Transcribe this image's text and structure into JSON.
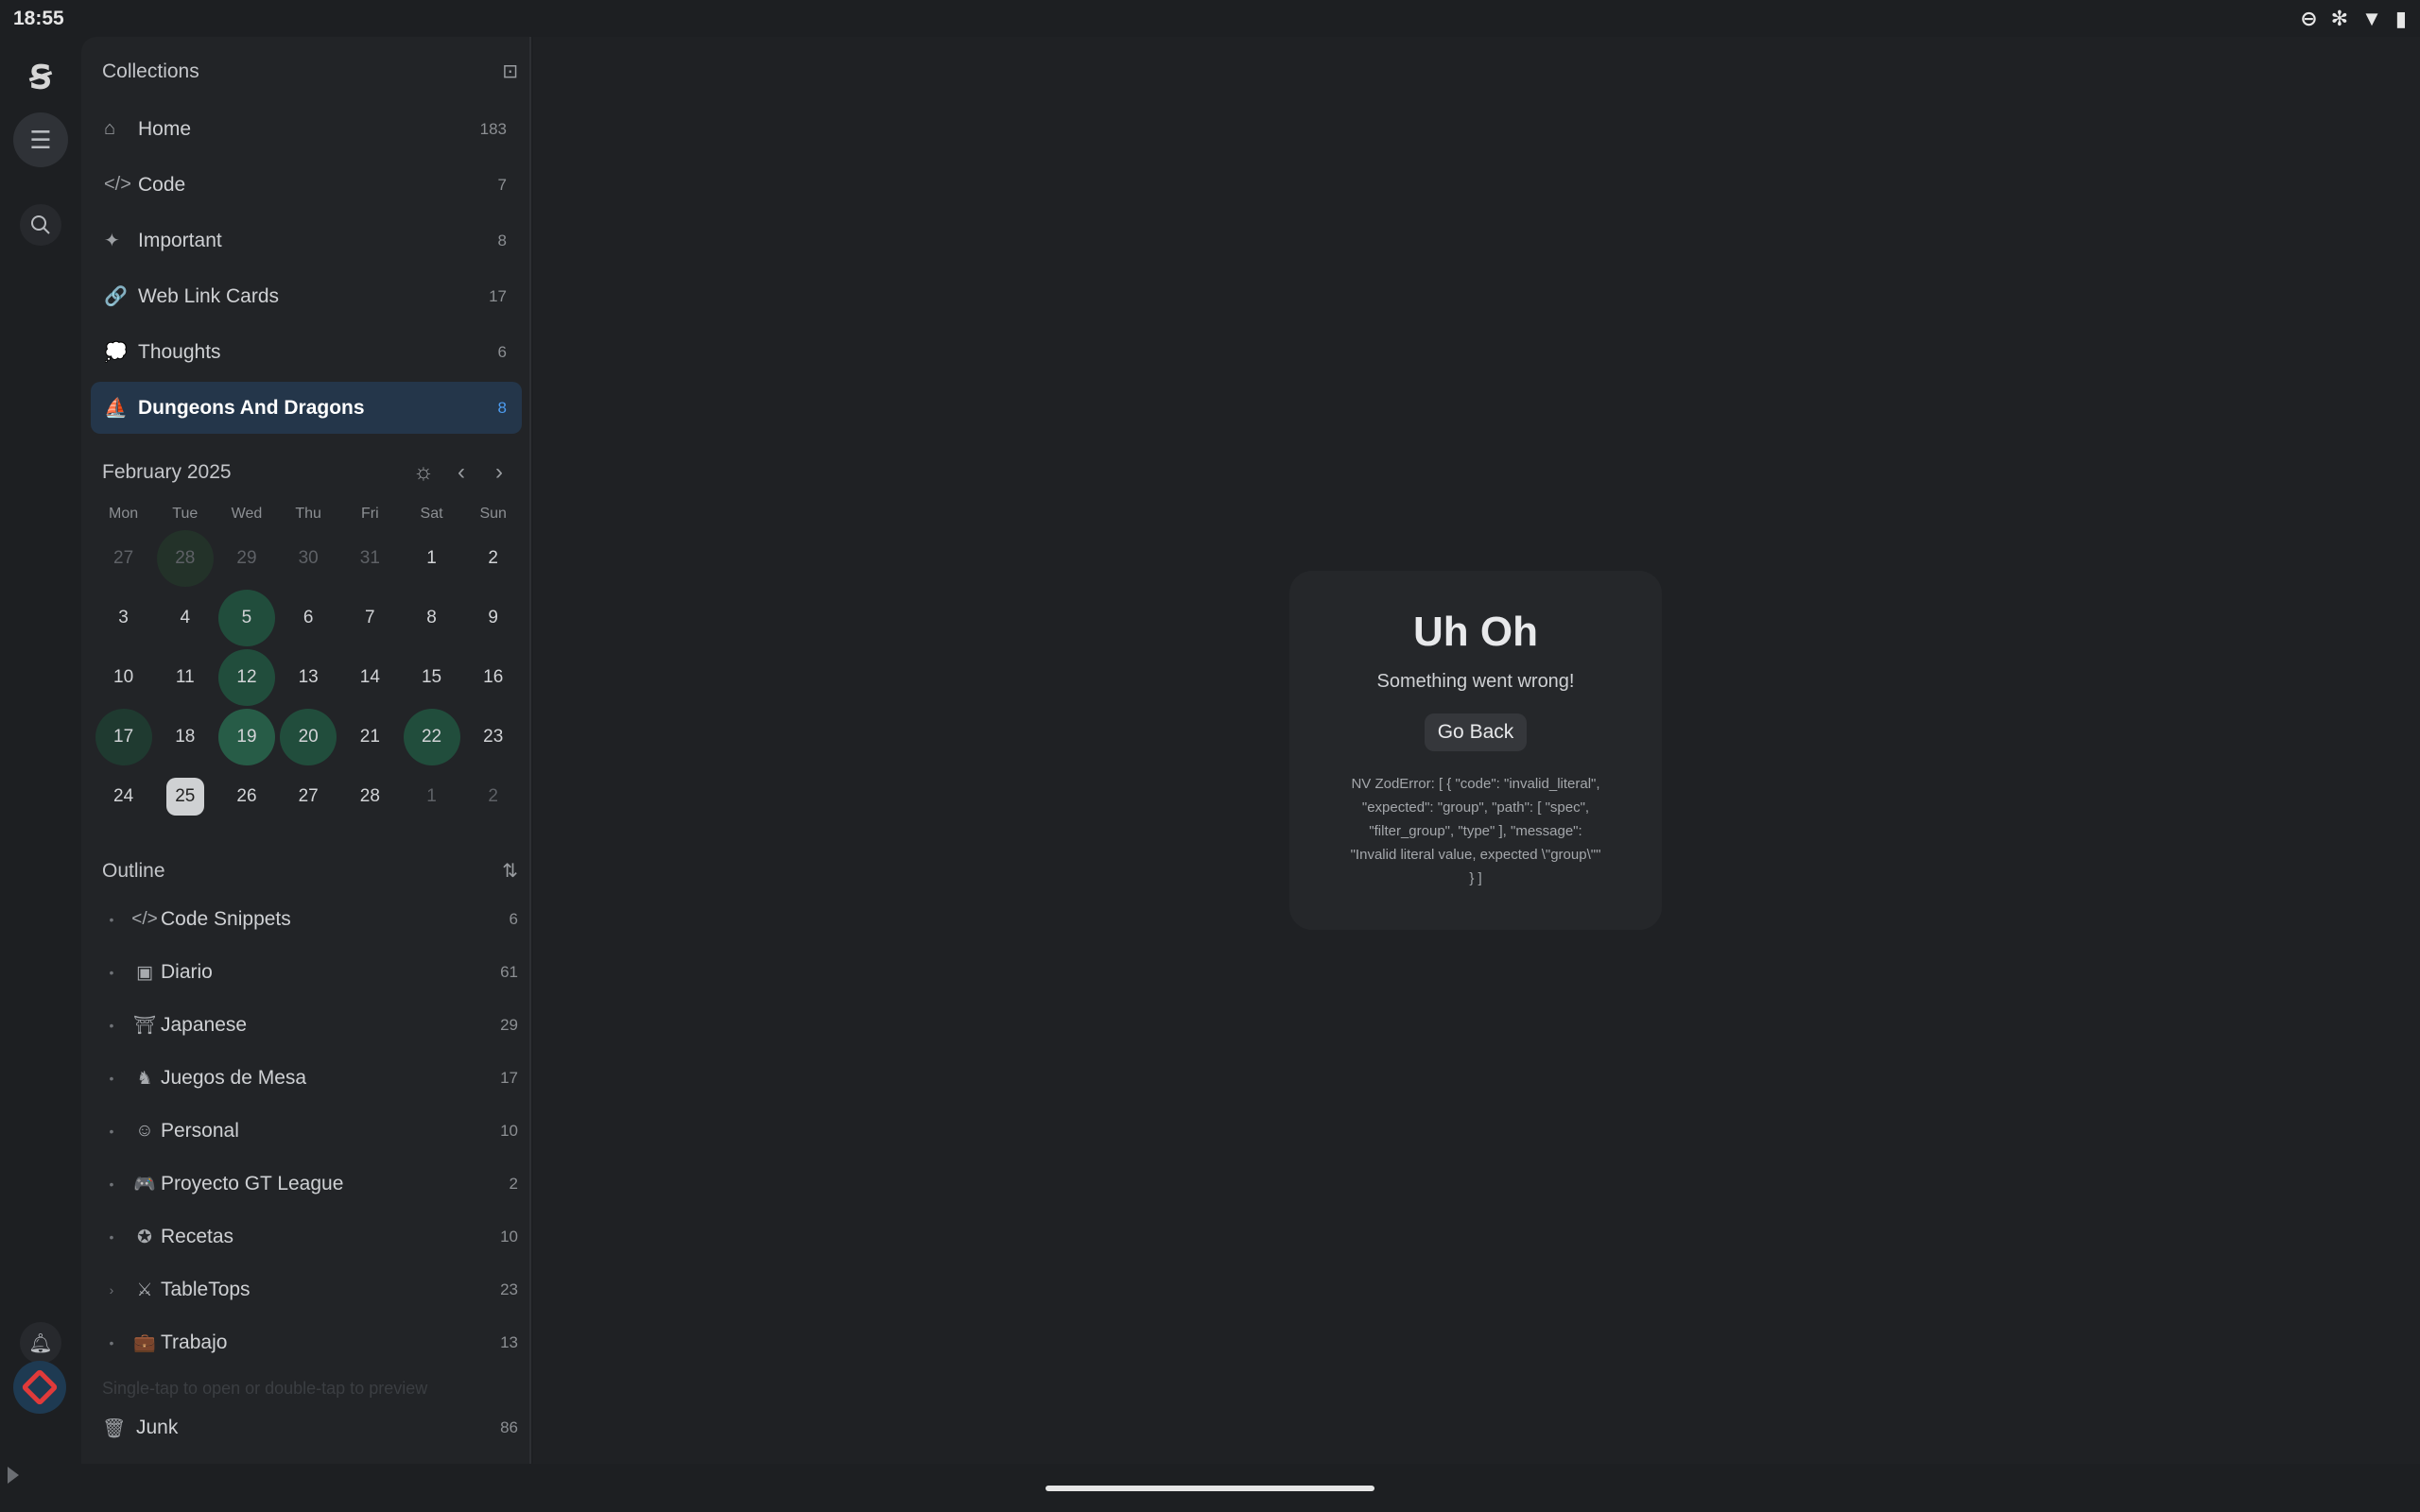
{
  "status_bar": {
    "time": "18:55",
    "icons": [
      "dnd-icon",
      "bluetooth-icon",
      "wifi-icon",
      "battery-icon"
    ]
  },
  "rail": {
    "logo": "ꞩ"
  },
  "collections": {
    "title": "Collections",
    "items": [
      {
        "label": "Home",
        "count": "183",
        "icon": "⌂",
        "active": false
      },
      {
        "label": "Code",
        "count": "7",
        "icon": "</>",
        "active": false
      },
      {
        "label": "Important",
        "count": "8",
        "icon": "✦",
        "active": false
      },
      {
        "label": "Web Link Cards",
        "count": "17",
        "icon": "🔗",
        "active": false
      },
      {
        "label": "Thoughts",
        "count": "6",
        "icon": "💭",
        "active": false
      },
      {
        "label": "Dungeons And Dragons",
        "count": "8",
        "icon": "⛵",
        "active": true
      }
    ]
  },
  "calendar": {
    "title": "February 2025",
    "weekdays": [
      "Mon",
      "Tue",
      "Wed",
      "Thu",
      "Fri",
      "Sat",
      "Sun"
    ],
    "days": [
      {
        "d": "27",
        "s": "muted"
      },
      {
        "d": "28",
        "s": "hm"
      },
      {
        "d": "29",
        "s": "muted"
      },
      {
        "d": "30",
        "s": "muted"
      },
      {
        "d": "31",
        "s": "muted"
      },
      {
        "d": "1",
        "s": ""
      },
      {
        "d": "2",
        "s": ""
      },
      {
        "d": "3",
        "s": ""
      },
      {
        "d": "4",
        "s": ""
      },
      {
        "d": "5",
        "s": "h2"
      },
      {
        "d": "6",
        "s": ""
      },
      {
        "d": "7",
        "s": ""
      },
      {
        "d": "8",
        "s": ""
      },
      {
        "d": "9",
        "s": ""
      },
      {
        "d": "10",
        "s": ""
      },
      {
        "d": "11",
        "s": ""
      },
      {
        "d": "12",
        "s": "h2"
      },
      {
        "d": "13",
        "s": ""
      },
      {
        "d": "14",
        "s": ""
      },
      {
        "d": "15",
        "s": ""
      },
      {
        "d": "16",
        "s": ""
      },
      {
        "d": "17",
        "s": "h1"
      },
      {
        "d": "18",
        "s": ""
      },
      {
        "d": "19",
        "s": "h3"
      },
      {
        "d": "20",
        "s": "h2"
      },
      {
        "d": "21",
        "s": ""
      },
      {
        "d": "22",
        "s": "h2"
      },
      {
        "d": "23",
        "s": ""
      },
      {
        "d": "24",
        "s": ""
      },
      {
        "d": "25",
        "s": "today"
      },
      {
        "d": "26",
        "s": ""
      },
      {
        "d": "27",
        "s": ""
      },
      {
        "d": "28",
        "s": ""
      },
      {
        "d": "1",
        "s": "muted"
      },
      {
        "d": "2",
        "s": "muted"
      }
    ]
  },
  "outline": {
    "title": "Outline",
    "items": [
      {
        "label": "Code Snippets",
        "count": "6",
        "icon": "</>",
        "bullet": "•"
      },
      {
        "label": "Diario",
        "count": "61",
        "icon": "▣",
        "bullet": "•"
      },
      {
        "label": "Japanese",
        "count": "29",
        "icon": "⛩",
        "bullet": "•"
      },
      {
        "label": "Juegos de Mesa",
        "count": "17",
        "icon": "♞",
        "bullet": "•"
      },
      {
        "label": "Personal",
        "count": "10",
        "icon": "☺",
        "bullet": "•"
      },
      {
        "label": "Proyecto GT League",
        "count": "2",
        "icon": "🎮",
        "bullet": "•"
      },
      {
        "label": "Recetas",
        "count": "10",
        "icon": "✪",
        "bullet": "•"
      },
      {
        "label": "TableTops",
        "count": "23",
        "icon": "⚔",
        "bullet": "›"
      },
      {
        "label": "Trabajo",
        "count": "13",
        "icon": "💼",
        "bullet": "•"
      }
    ]
  },
  "faded_tip": "Single-tap to open or double-tap to preview",
  "junk": {
    "label": "Junk",
    "count": "86",
    "icon": "🗑"
  },
  "error": {
    "title": "Uh Oh",
    "subtitle": "Something went wrong!",
    "button": "Go Back",
    "detail": "NV ZodError: [ { \"code\": \"invalid_literal\", \"expected\": \"group\", \"path\": [ \"spec\", \"filter_group\", \"type\" ], \"message\": \"Invalid literal value, expected \\\"group\\\"\" } ]"
  },
  "colors": {
    "accent": "#4d9cf0",
    "active_bg": "#24364a",
    "calendar_highlight": "#214d3c",
    "danger": "#e03a3a"
  }
}
